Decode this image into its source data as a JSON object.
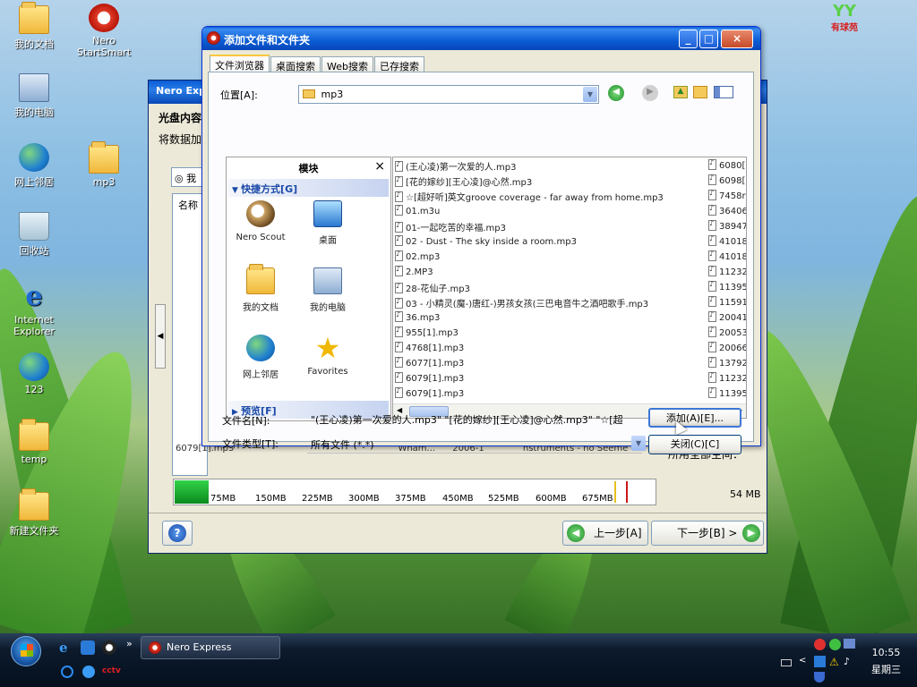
{
  "desktop": {
    "icons": [
      {
        "label": "我的文档",
        "type": "folder"
      },
      {
        "label": "我的电脑",
        "type": "pc"
      },
      {
        "label": "网上邻居",
        "type": "globe"
      },
      {
        "label": "回收站",
        "type": "bin"
      },
      {
        "label": "Internet Explorer",
        "type": "ie"
      },
      {
        "label": "123",
        "type": "globe"
      },
      {
        "label": "temp",
        "type": "folder"
      },
      {
        "label": "新建文件夹",
        "type": "folder"
      },
      {
        "label": "Nero StartSmart",
        "type": "nero"
      },
      {
        "label": "mp3",
        "type": "folder"
      }
    ]
  },
  "back_window": {
    "title": "Nero Express",
    "heading": "光盘内容",
    "subheading": "将数据加",
    "col_name": "名称",
    "row_text": "6079[1].mp3",
    "row_extra": "Wham...",
    "row_extra2": "2006-1",
    "row_extra3": "nstruments - no Seemed...",
    "free_space_label": "所用全部空间：",
    "capacity_marks": [
      "75MB",
      "150MB",
      "225MB",
      "300MB",
      "375MB",
      "450MB",
      "525MB",
      "600MB",
      "675MB"
    ],
    "capacity_used": "54 MB",
    "back_button": "上一步[A]",
    "next_button": "下一步[B] >",
    "help_icon": "?"
  },
  "dialog": {
    "title": "添加文件和文件夹",
    "tabs": [
      "文件浏览器",
      "桌面搜索",
      "Web搜索",
      "已存搜索"
    ],
    "location_label": "位置[A]:",
    "location_value": "mp3",
    "module_title": "模块",
    "shortcuts_label": "快捷方式[G]",
    "shortcuts": [
      "Nero Scout",
      "桌面",
      "我的文档",
      "我的电脑",
      "网上邻居",
      "Favorites"
    ],
    "preview_label": "预览[F]",
    "files": [
      "(王心凌)第一次爱的人.mp3",
      "[花的嫁纱][王心凌]@心然.mp3",
      "☆[超好听]英文groove coverage - far away from home.mp3",
      "01.m3u",
      "01-一起吃苦的幸福.mp3",
      "02 - Dust - The sky inside a room.mp3",
      "02.mp3",
      "2.MP3",
      "28-花仙子.mp3",
      "03 - 小精灵(魔-)唐红-)男孩女孩(三巴电音牛之酒吧歌手.mp3",
      "36.mp3",
      "955[1].mp3",
      "4768[1].mp3",
      "6077[1].mp3",
      "6079[1].mp3",
      "6079[1].mp3"
    ],
    "sizes": [
      "6080[",
      "6098[",
      "7458r",
      "36406",
      "38947",
      "41018",
      "41018",
      "11232",
      "11395",
      "11591",
      "20041",
      "20053",
      "20066",
      "13792",
      "11232",
      "11395"
    ],
    "filename_label": "文件名[N]:",
    "filename_value": "\"(王心凌)第一次爱的人.mp3\" \"[花的嫁纱][王心凌]@心然.mp3\" \"☆[超",
    "filetype_label": "文件类型[T]:",
    "filetype_value": "所有文件 (*.*)",
    "add_button": "添加(A)[E]...",
    "close_button": "关闭(C)[C]",
    "min": "_",
    "max": "□",
    "close": "×"
  },
  "taskbar": {
    "task": "Nero Express",
    "time": "10:55",
    "day": "星期三"
  },
  "brand": "有球苑"
}
